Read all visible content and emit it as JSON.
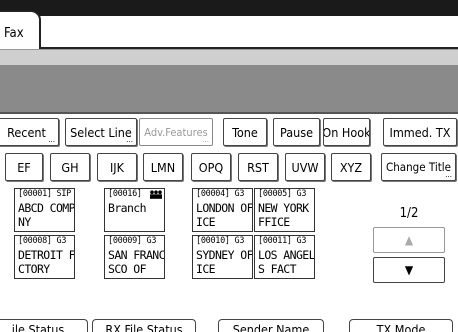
{
  "tabs": {
    "fax": "Fax"
  },
  "row1": {
    "recent": "Recent",
    "select_line": "Select Line",
    "adv_features": "Adv.Features",
    "tone": "Tone",
    "pause": "Pause",
    "on_hook": "On Hook",
    "immed_tx": "Immed. TX"
  },
  "row2": {
    "ef": "EF",
    "gh": "GH",
    "ijk": "IJK",
    "lmn": "LMN",
    "opq": "OPQ",
    "rst": "RST",
    "uvw": "UVW",
    "xyz": "XYZ",
    "change_title": "Change Title"
  },
  "destinations": [
    {
      "code": "[00001] SIP",
      "line1": "ABCD COMPA",
      "line2": "NY"
    },
    {
      "code": "[00016]",
      "group_icon": "group-icon",
      "line1": "Branch",
      "line2": ""
    },
    {
      "code": "[00004] G3",
      "line1": "LONDON OFF",
      "line2": "ICE"
    },
    {
      "code": "[00005] G3",
      "line1": "NEW YORK O",
      "line2": "FFICE"
    },
    {
      "code": "[00008] G3",
      "line1": "DETROIT FA",
      "line2": "CTORY"
    },
    {
      "code": "[00009] G3",
      "line1": "SAN FRANCI",
      "line2": "SCO OF"
    },
    {
      "code": "[00010] G3",
      "line1": "SYDNEY OFF",
      "line2": "ICE"
    },
    {
      "code": "[00011] G3",
      "line1": "LOS ANGELE",
      "line2": "S FACT"
    }
  ],
  "pager": {
    "indicator": "1/2",
    "up_icon": "triangle-up-icon",
    "down_icon": "triangle-down-icon"
  },
  "bottom_tabs": [
    "ile Status",
    "RX File Status",
    "Sender Name",
    "TX Mode"
  ]
}
